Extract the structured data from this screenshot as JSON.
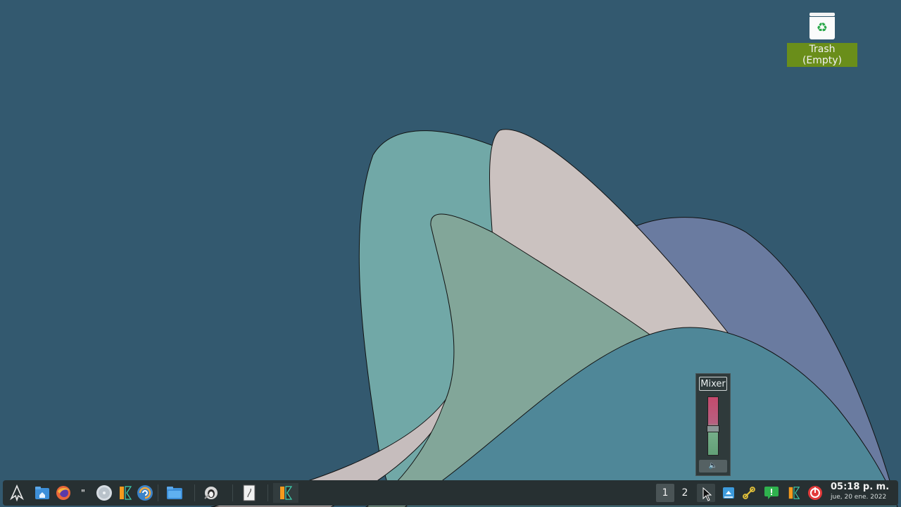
{
  "desktop": {
    "trash_label": "Trash (Empty)",
    "trash_icon": "recycle-icon"
  },
  "mixer": {
    "label": "Mixer",
    "volume_fraction": 0.45,
    "mute_icon": "speaker-icon"
  },
  "taskbar": {
    "launchers": [
      {
        "name": "menu",
        "icon": "penguin-icon"
      },
      {
        "name": "home-folder",
        "icon": "home-folder-icon"
      },
      {
        "name": "firefox",
        "icon": "firefox-icon"
      },
      {
        "name": "terminal",
        "icon": "terminal-icon"
      },
      {
        "name": "disc",
        "icon": "disc-icon"
      },
      {
        "name": "app-x",
        "icon": "x-app-icon"
      },
      {
        "name": "updater",
        "icon": "globe-refresh-icon"
      }
    ],
    "windows": [
      {
        "name": "files",
        "icon": "folder-icon"
      },
      {
        "name": "settings-tool",
        "icon": "tux-tool-icon"
      },
      {
        "name": "text-editor",
        "icon": "document-icon"
      },
      {
        "name": "x-app-window",
        "icon": "x-app-icon"
      }
    ],
    "workspaces": [
      "1",
      "2"
    ],
    "tray": [
      "volume-icon",
      "network-icon",
      "link-icon",
      "notification-icon",
      "x-app-icon",
      "power-icon"
    ],
    "clock": {
      "time": "05:18 p. m.",
      "date": "jue, 20 ene. 2022"
    }
  },
  "colors": {
    "background": "#33596f",
    "taskbar": "#273032",
    "accent_green": "#6a8e1a"
  }
}
